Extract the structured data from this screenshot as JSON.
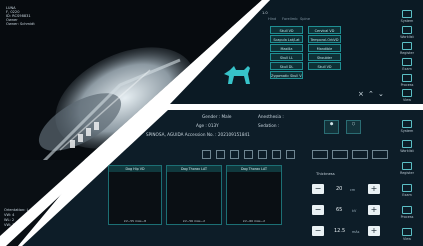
{
  "patient": {
    "name": "LUNA",
    "sex": "F, 0220",
    "id": "ID: RCS98831",
    "owner_label": "Owner",
    "owner_name": "Owner: Schmidt"
  },
  "acquisition": {
    "acq": "Acq: 11/10/20",
    "status": "Ini 8%",
    "extra": "1.0"
  },
  "region_tabs": [
    "Hind",
    "Forelimb",
    "Spine"
  ],
  "exam_buttons": [
    "Skull VD",
    "Cervical VD",
    "Scapula Lat/Lat",
    "Temporal-OrbVD",
    "Maxilla",
    "Mandible",
    "Skull LL",
    "Shoulder",
    "Skull DL",
    "Skull VD",
    "Zygomatic Skull VD"
  ],
  "right_nav": [
    "System",
    "Worklist",
    "Register",
    "Exam",
    "Process",
    "View"
  ],
  "patient_bar": {
    "gender": "Gender : Male",
    "anesthesia": "Anesthesia :",
    "age": "Age : 013Y",
    "sedation": "Sedation :",
    "name_line": "SPINOSA, AGUIDA Accession No. : 202109151841"
  },
  "thumbnails": [
    {
      "title": "Dog Hip VD",
      "caption": "kV~55 mAs~8"
    },
    {
      "title": "Dog Thorax LAT",
      "caption": "kV~56 mAs~2"
    },
    {
      "title": "Dog Thorax LAT",
      "caption": "kV~60 mAs~2"
    }
  ],
  "lower_nav": [
    "System",
    "Worklist",
    "Register",
    "Exam",
    "Process",
    "View"
  ],
  "thickness_label": "Thickness",
  "settings": [
    {
      "value": "20",
      "unit": "cm"
    },
    {
      "value": "65",
      "unit": "kV"
    },
    {
      "value": "12.5",
      "unit": "mAs"
    }
  ],
  "overlay_left": {
    "orient": "Orientation: L",
    "l1": "VW: 4",
    "l2": "WL: 2",
    "l3": "VW: 1"
  }
}
